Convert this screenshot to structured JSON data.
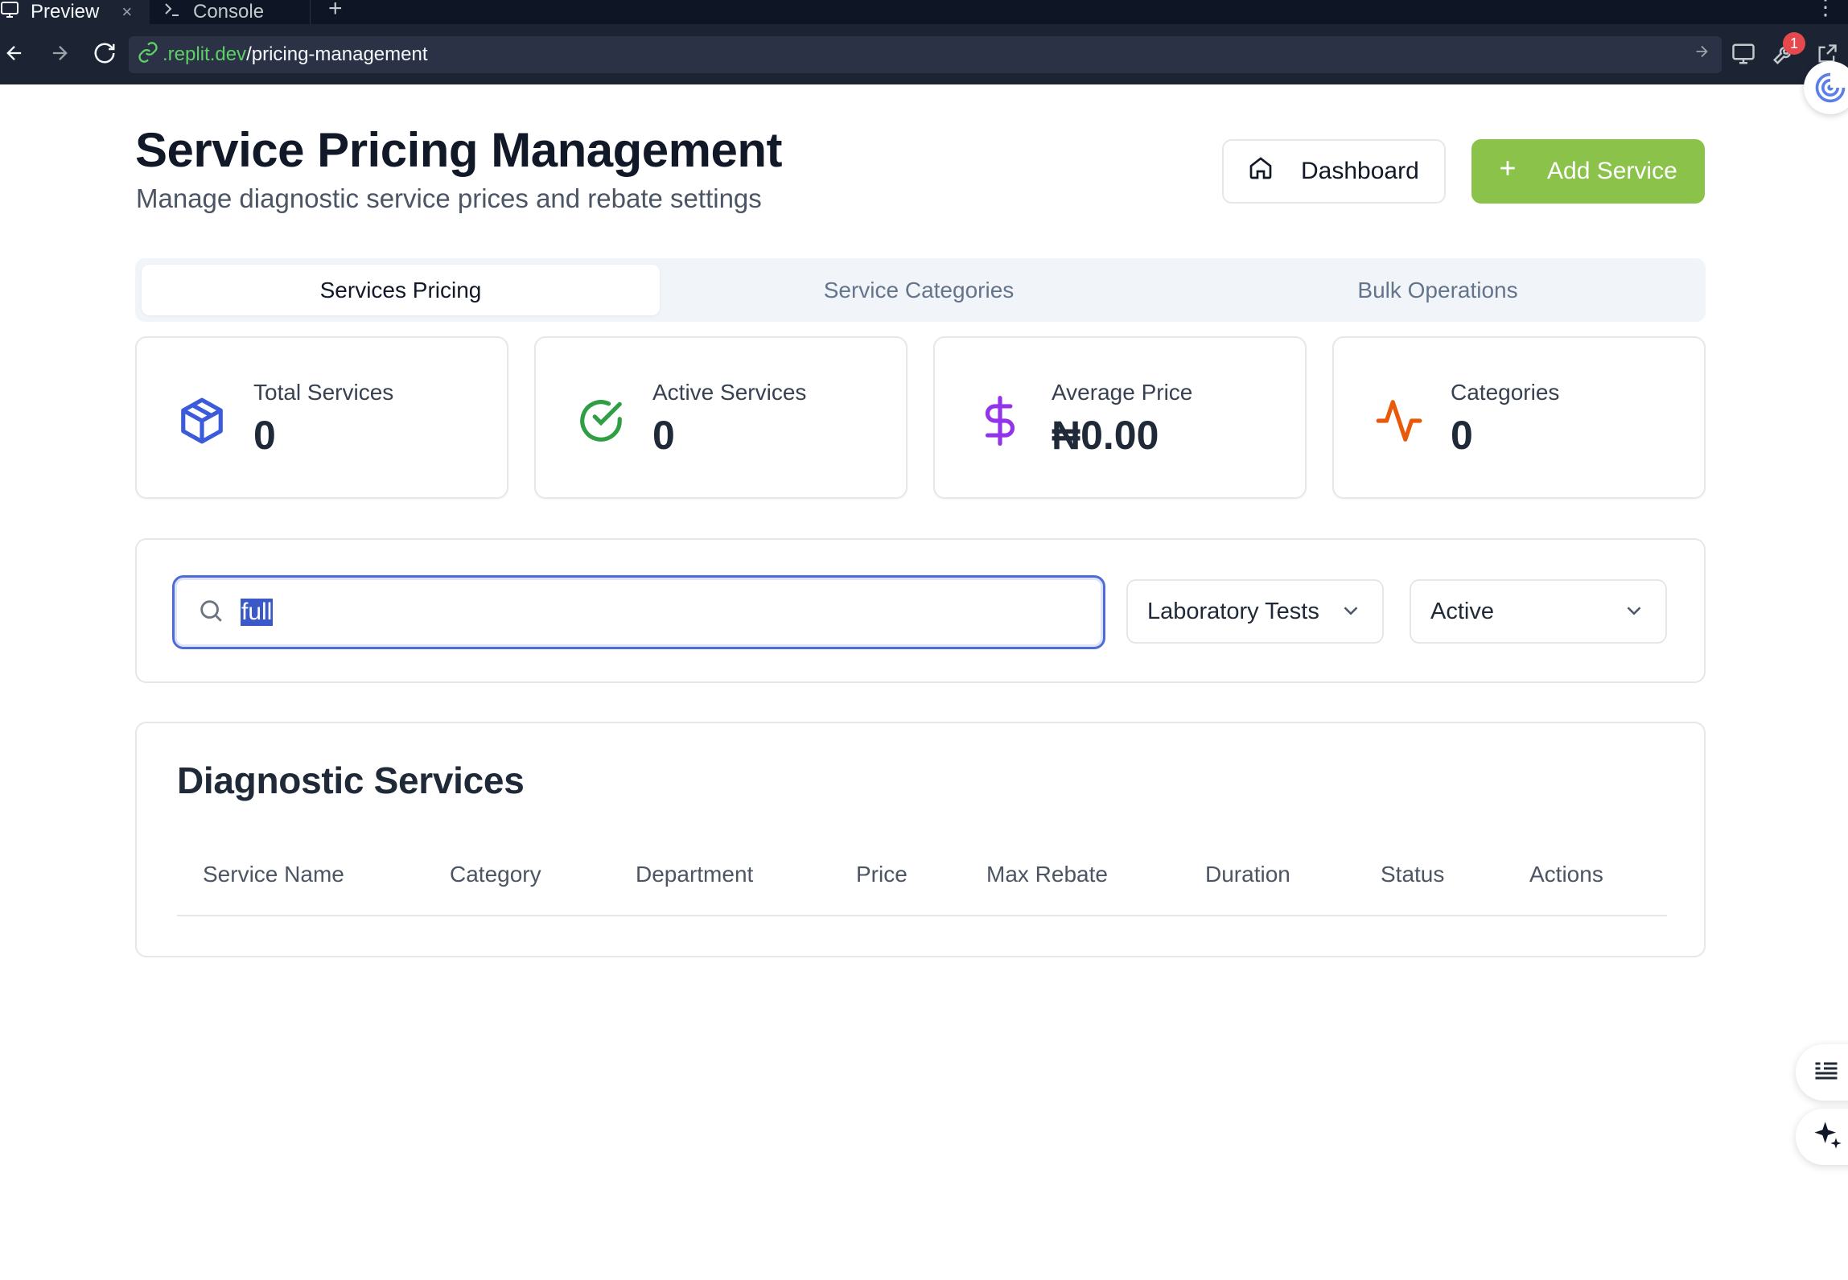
{
  "browser": {
    "tabs": [
      {
        "label": "Preview",
        "close": "×"
      },
      {
        "label": "Console"
      }
    ],
    "new_tab": "+",
    "more": "⋮",
    "url_domain": ".replit.dev",
    "url_path": "/pricing-management",
    "notification_count": "1"
  },
  "header": {
    "title": "Service Pricing Management",
    "subtitle": "Manage diagnostic service prices and rebate settings",
    "dashboard_label": "Dashboard",
    "add_service_label": "Add Service"
  },
  "tabs": [
    {
      "label": "Services Pricing",
      "active": true
    },
    {
      "label": "Service Categories",
      "active": false
    },
    {
      "label": "Bulk Operations",
      "active": false
    }
  ],
  "stats": [
    {
      "label": "Total Services",
      "value": "0",
      "icon": "package-icon",
      "color": "#3b5bdb"
    },
    {
      "label": "Active Services",
      "value": "0",
      "icon": "check-circle-icon",
      "color": "#2f9e44"
    },
    {
      "label": "Average Price",
      "value": "₦0.00",
      "icon": "dollar-sign-icon",
      "color": "#9333ea"
    },
    {
      "label": "Categories",
      "value": "0",
      "icon": "activity-icon",
      "color": "#e8590c"
    }
  ],
  "filters": {
    "search_value": "full",
    "category_selected": "Laboratory Tests",
    "status_selected": "Active"
  },
  "table": {
    "title": "Diagnostic Services",
    "columns": [
      "Service Name",
      "Category",
      "Department",
      "Price",
      "Max Rebate",
      "Duration",
      "Status",
      "Actions"
    ]
  },
  "colors": {
    "accent_green": "#8bc34a",
    "focus_blue": "#4f6bd6"
  }
}
